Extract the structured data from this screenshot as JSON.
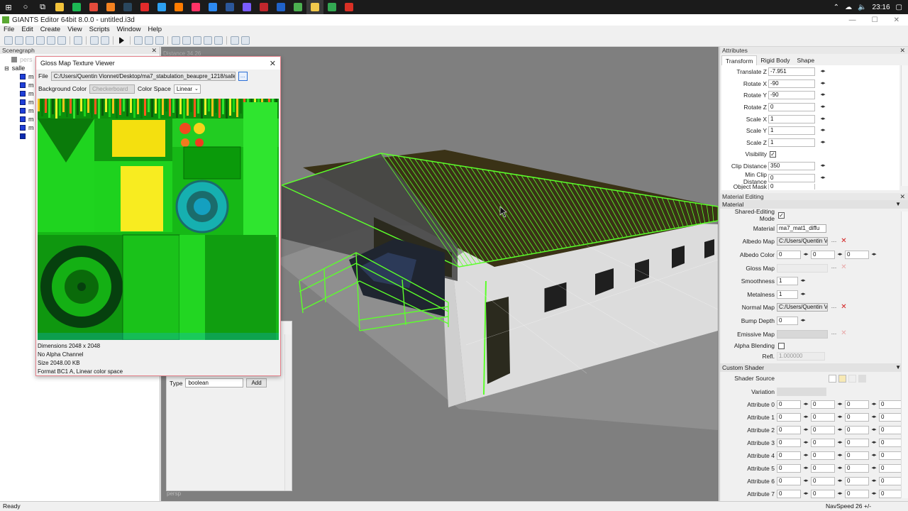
{
  "taskbar": {
    "tray": {
      "time": "23:16"
    },
    "apps": [
      {
        "name": "explorer",
        "color": "#f3c33a"
      },
      {
        "name": "spotify",
        "color": "#1db954"
      },
      {
        "name": "chrome",
        "color": "#e44b3b"
      },
      {
        "name": "blender",
        "color": "#f58220"
      },
      {
        "name": "steam",
        "color": "#2a475e"
      },
      {
        "name": "acrobat",
        "color": "#e32b2b"
      },
      {
        "name": "photoshop",
        "color": "#2da0f0"
      },
      {
        "name": "illustrator",
        "color": "#ff7c00"
      },
      {
        "name": "indesign",
        "color": "#ff3366"
      },
      {
        "name": "notepad",
        "color": "#2d89ef"
      },
      {
        "name": "word",
        "color": "#2b579a"
      },
      {
        "name": "tool",
        "color": "#7a5cff"
      },
      {
        "name": "app-red",
        "color": "#c1272d"
      },
      {
        "name": "app-blue",
        "color": "#2062c9"
      },
      {
        "name": "app-green",
        "color": "#4caf50"
      },
      {
        "name": "giants-editor",
        "color": "#f2c94c"
      },
      {
        "name": "app-green2",
        "color": "#33a852"
      },
      {
        "name": "app-red2",
        "color": "#d93025"
      }
    ]
  },
  "window": {
    "title": "GIANTS Editor 64bit 8.0.0 - untitled.i3d"
  },
  "menu": [
    "File",
    "Edit",
    "Create",
    "View",
    "Scripts",
    "Window",
    "Help"
  ],
  "scenegraph": {
    "title": "Scenegraph",
    "items": [
      {
        "label": "pers"
      },
      {
        "label": "salle"
      },
      {
        "label": "m"
      },
      {
        "label": "m"
      },
      {
        "label": "m"
      },
      {
        "label": "m"
      },
      {
        "label": "m"
      },
      {
        "label": "m"
      },
      {
        "label": "m"
      },
      {
        "label": ""
      }
    ]
  },
  "texture_viewer": {
    "title": "Gloss Map Texture Viewer",
    "file_label": "File",
    "file_path": "C:/Users/Quentin Vionnet/Desktop/ma7_stabulation_beaupre_1218/salle_...",
    "browse_label": "...",
    "bg_label": "Background Color",
    "bg_value": "Checkerboard",
    "colorspace_label": "Color Space",
    "colorspace_value": "Linear",
    "info": [
      "Dimensions 2048 x 2048",
      "No Alpha Channel",
      "Size 2048.00 KB",
      "Format BC1 A, Linear color space"
    ]
  },
  "user_attributes": {
    "type_label": "Type",
    "type_value": "boolean",
    "add_label": "Add"
  },
  "viewport": {
    "distance": "Distance 34.26",
    "camera": "persp"
  },
  "attributes": {
    "title": "Attributes",
    "tabs": [
      "Transform",
      "Rigid Body",
      "Shape"
    ],
    "rows": [
      {
        "label": "Translate Z",
        "value": "-7.951"
      },
      {
        "label": "Rotate X",
        "value": "-90"
      },
      {
        "label": "Rotate Y",
        "value": "-90"
      },
      {
        "label": "Rotate Z",
        "value": "0"
      },
      {
        "label": "Scale X",
        "value": "1"
      },
      {
        "label": "Scale Y",
        "value": "1"
      },
      {
        "label": "Scale Z",
        "value": "1"
      }
    ],
    "visibility_label": "Visibility",
    "visibility_checked": "✓",
    "clip_label": "Clip Distance",
    "clip_value": "350",
    "minclip_label": "Min Clip Distance",
    "minclip_value": "0",
    "objmask_label": "Object Mask",
    "objmask_value": "0"
  },
  "material": {
    "panel_title": "Material Editing",
    "section_title": "Material",
    "shared_label": "Shared-Editing Mode",
    "shared_checked": "✓",
    "material_label": "Material",
    "material_value": "ma7_mat1_diffu",
    "albedo_map_label": "Albedo Map",
    "albedo_map_value": "C:/Users/Quentin V",
    "albedo_color_label": "Albedo Color",
    "albedo_color_values": [
      "0",
      "0",
      "0"
    ],
    "gloss_label": "Gloss Map",
    "smooth_label": "Smoothness",
    "smooth_value": "1",
    "metal_label": "Metalness",
    "metal_value": "1",
    "normal_label": "Normal Map",
    "normal_value": "C:/Users/Quentin V",
    "bump_label": "Bump Depth",
    "bump_value": "0",
    "emissive_label": "Emissive Map",
    "alpha_label": "Alpha Blending",
    "refl_label": "Refl.",
    "refl_value": "1.000000",
    "custom_shader_title": "Custom Shader",
    "shader_source_label": "Shader Source",
    "variation_label": "Variation",
    "attributes": [
      {
        "label": "Attribute 0",
        "values": [
          "0",
          "0",
          "0",
          "0"
        ]
      },
      {
        "label": "Attribute 1",
        "values": [
          "0",
          "0",
          "0",
          "0"
        ]
      },
      {
        "label": "Attribute 2",
        "values": [
          "0",
          "0",
          "0",
          "0"
        ]
      },
      {
        "label": "Attribute 3",
        "values": [
          "0",
          "0",
          "0",
          "0"
        ]
      },
      {
        "label": "Attribute 4",
        "values": [
          "0",
          "0",
          "0",
          "0"
        ]
      },
      {
        "label": "Attribute 5",
        "values": [
          "0",
          "0",
          "0",
          "0"
        ]
      },
      {
        "label": "Attribute 6",
        "values": [
          "0",
          "0",
          "0",
          "0"
        ]
      },
      {
        "label": "Attribute 7",
        "values": [
          "0",
          "0",
          "0",
          "0"
        ]
      }
    ]
  },
  "status": {
    "left": "Ready",
    "right": "NavSpeed 26 +/-"
  },
  "colors": {
    "taskbar": "#1b1b1b",
    "viewport_bg": "#7f7f7f",
    "wire_green": "#39ff14",
    "dialog_border": "#e4808a"
  }
}
